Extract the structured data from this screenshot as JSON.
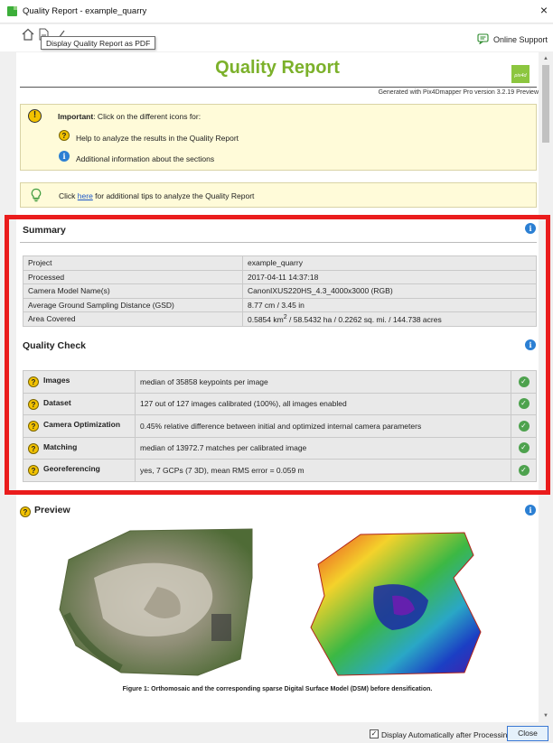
{
  "window": {
    "title": "Quality Report - example_quarry",
    "close_glyph": "×"
  },
  "toolbar": {
    "tooltip": "Display Quality Report as PDF",
    "support_label": "Online Support",
    "icons": [
      "home-icon",
      "pdf-icon",
      "attach-icon",
      "support-icon"
    ]
  },
  "report": {
    "title": "Quality Report",
    "logo_text": "pix4d",
    "generated": "Generated with Pix4Dmapper Pro version 3.2.19 Preview",
    "important": {
      "prefix": "Important",
      "text": ": Click on the different icons for:",
      "help_line": "Help to analyze the results in the Quality Report",
      "info_line": "Additional information about the sections"
    },
    "tip": {
      "before": "Click ",
      "link": "here",
      "after": " for additional tips to analyze the Quality Report"
    }
  },
  "summary": {
    "heading": "Summary",
    "rows": [
      {
        "key": "Project",
        "value": "example_quarry"
      },
      {
        "key": "Processed",
        "value": "2017-04-11 14:37:18"
      },
      {
        "key": "Camera Model Name(s)",
        "value": "CanonIXUS220HS_4.3_4000x3000 (RGB)"
      },
      {
        "key": "Average Ground Sampling Distance (GSD)",
        "value": "8.77 cm / 3.45 in"
      },
      {
        "key": "Area Covered",
        "value_prefix": "0.5854 km",
        "value_sup": "2",
        "value_suffix": " / 58.5432 ha / 0.2262 sq. mi. / 144.738 acres"
      }
    ]
  },
  "quality_check": {
    "heading": "Quality Check",
    "rows": [
      {
        "key": "Images",
        "value": "median of 35858 keypoints per image",
        "status": "ok"
      },
      {
        "key": "Dataset",
        "value": "127 out of 127 images calibrated (100%), all images enabled",
        "status": "ok"
      },
      {
        "key": "Camera Optimization",
        "value": "0.45% relative difference between initial and optimized internal camera parameters",
        "status": "ok"
      },
      {
        "key": "Matching",
        "value": "median of 13972.7 matches per calibrated image",
        "status": "ok"
      },
      {
        "key": "Georeferencing",
        "value": "yes, 7 GCPs (7 3D), mean RMS error = 0.059 m",
        "status": "ok"
      }
    ]
  },
  "preview": {
    "heading": "Preview",
    "caption": "Figure 1: Orthomosaic and the corresponding sparse Digital Surface Model (DSM) before densification."
  },
  "statusbar": {
    "auto_display_label": "Display Automatically after Processing",
    "auto_display_checked": true,
    "close_label": "Close"
  },
  "colors": {
    "title_green": "#7cb12b",
    "highlight_red": "#ea1c1c",
    "notice_bg": "#fffbd9",
    "check_green": "#4ea24e",
    "info_blue": "#2b7fd3"
  }
}
